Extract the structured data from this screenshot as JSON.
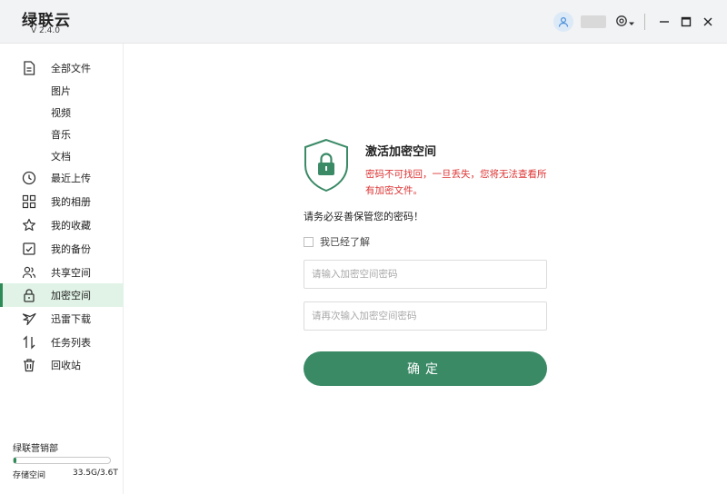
{
  "app": {
    "name": "绿联云",
    "version": "V 2.4.0"
  },
  "titlebar": {
    "icons": [
      "user-icon",
      "settings-icon",
      "chevron-down-icon",
      "minimize-icon",
      "maximize-icon",
      "close-icon"
    ]
  },
  "sidebar": {
    "items": [
      {
        "label": "全部文件",
        "icon": "file-icon"
      },
      {
        "label": "图片"
      },
      {
        "label": "视频"
      },
      {
        "label": "音乐"
      },
      {
        "label": "文档"
      },
      {
        "label": "最近上传",
        "icon": "clock-icon"
      },
      {
        "label": "我的相册",
        "icon": "grid-icon"
      },
      {
        "label": "我的收藏",
        "icon": "star-icon"
      },
      {
        "label": "我的备份",
        "icon": "backup-icon"
      },
      {
        "label": "共享空间",
        "icon": "users-icon"
      },
      {
        "label": "加密空间",
        "icon": "lock-icon",
        "active": true
      },
      {
        "label": "迅雷下载",
        "icon": "bird-icon"
      },
      {
        "label": "任务列表",
        "icon": "transfer-icon"
      },
      {
        "label": "回收站",
        "icon": "trash-icon"
      }
    ],
    "storage": {
      "owner": "绿联营销部",
      "label": "存储空间",
      "value": "33.5G/3.6T",
      "fraction": 0.009
    }
  },
  "main": {
    "title": "激活加密空间",
    "warning": "密码不可找回，一旦丢失，您将无法查看所有加密文件。",
    "note": "请务必妥善保管您的密码！",
    "ack_label": "我已经了解",
    "ack_checked": false,
    "password_placeholder": "请输入加密空间密码",
    "confirm_placeholder": "请再次输入加密空间密码",
    "confirm_button": "确定"
  },
  "colors": {
    "accent": "#3a8a66",
    "warning": "#dd3333",
    "active_bg": "#e1f3e7"
  }
}
